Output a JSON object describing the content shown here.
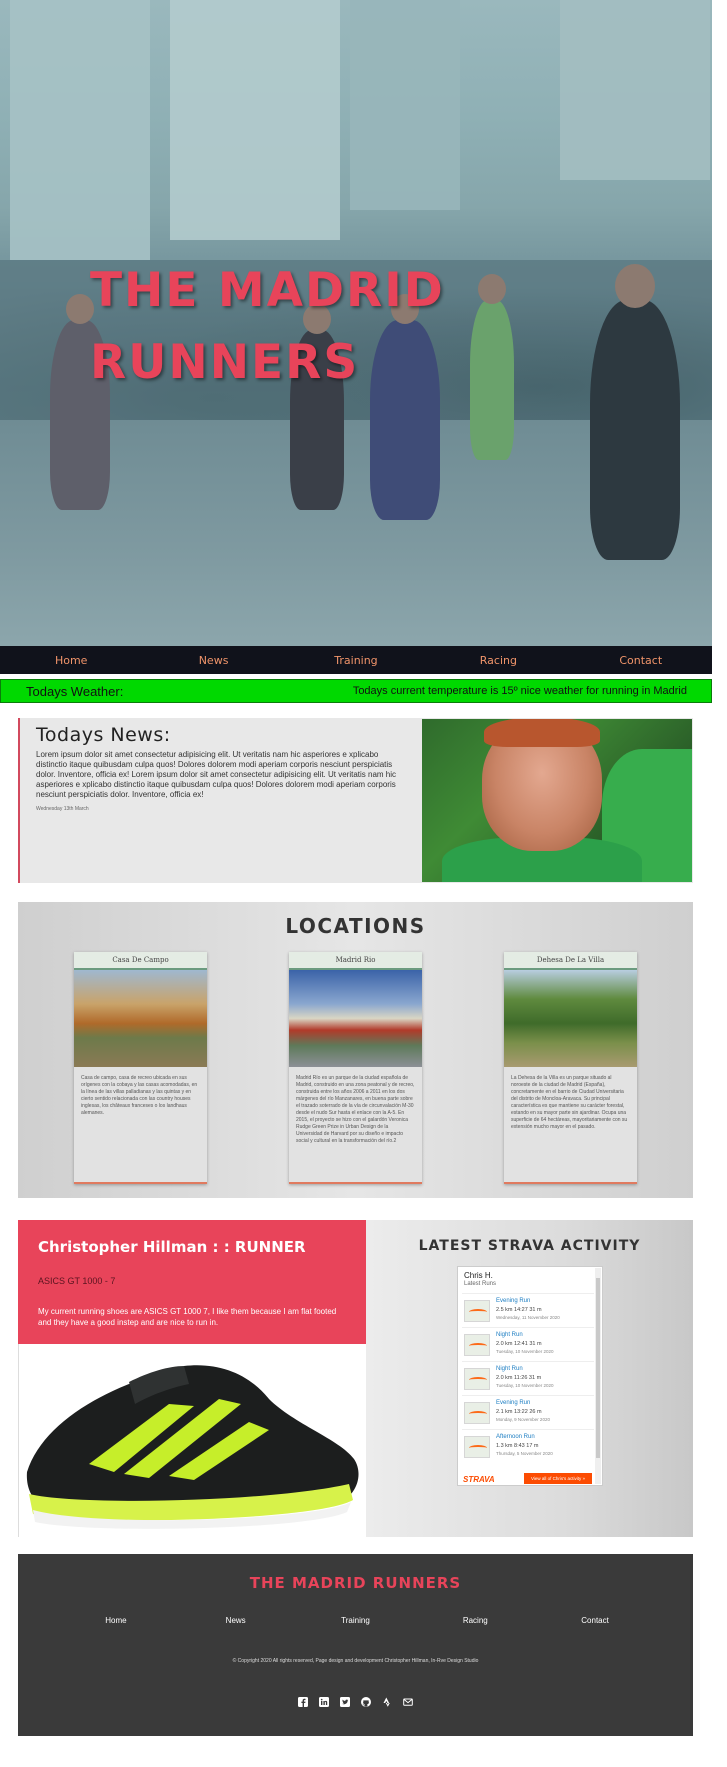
{
  "hero": {
    "title_line1": "THE MADRID",
    "title_line2": "RUNNERS"
  },
  "nav": [
    "Home",
    "News",
    "Training",
    "Racing",
    "Contact"
  ],
  "weather": {
    "label": "Todays Weather:",
    "message": "Todays current temperature is 15º nice weather for running in Madrid"
  },
  "news": {
    "title": "Todays News:",
    "body": "Lorem ipsum dolor sit amet consectetur adipisicing elit. Ut veritatis nam hic asperiores e xplicabo distinctio itaque quibusdam culpa quos! Dolores dolorem modi aperiam corporis nesciunt perspiciatis dolor. Inventore, officia ex! Lorem ipsum dolor sit amet consectetur adipisicing elit. Ut veritatis nam hic asperiores e xplicabo distinctio itaque quibusdam culpa quos! Dolores dolorem modi aperiam corporis nesciunt perspiciatis dolor. Inventore, officia ex!",
    "date": "Wednesday 13th March"
  },
  "locations": {
    "title": "LOCATIONS",
    "cards": [
      {
        "title": "Casa De Campo",
        "text": "Casa de campo, casa de recreo ubicada en sus orígenes con la cobaya y las casas acomodadas, en la línea de las villas palladianas y las quintas y en cierto sentido relacionada con las country houses inglesas, los châteaux franceses o los landhaus alemanes."
      },
      {
        "title": "Madrid Rio",
        "text": "Madrid Río es un parque de la ciudad española de Madrid, construido en una zona peatonal y de recreo, construida entre los años 2006 a 2011 en los dos márgenes del río Manzanares, en buena parte sobre el trazado soterrado de la vía de circunvalación M-30 desde el nudo Sur hasta el enlace con la A-5. En 2015, el proyecto se hizo con el galardón Veronica Rudge Green Prize in Urban Design de la Universidad de Harvard por su diseño e impacto social y cultural en la transformación del río.2"
      },
      {
        "title": "Dehesa De La Villa",
        "text": "La Dehesa de la Villa es un parque situado al noroeste de la ciudad de Madrid (España), concretamente en el barrio de Ciudad Universitaria del distrito de Moncloa-Aravaca. Su principal característica es que mantiene su carácter forestal, estando en su mayor parte sin ajardinar. Ocupa una superficie de 64 hectáreas, mayoritariamente con su extensión mucho mayor en el pasado."
      }
    ]
  },
  "runner": {
    "title": "Christopher Hillman : : RUNNER",
    "model": "ASICS GT 1000 - 7",
    "desc": "My current running shoes are ASICS GT 1000 7, I like them because I am flat footed and they have a good instep and are nice to run in."
  },
  "strava": {
    "title": "LATEST STRAVA ACTIVITY",
    "athlete": "Chris H.",
    "subtitle": "Latest Runs",
    "activities": [
      {
        "name": "Evening Run",
        "stats": "2.5 km    14:27    31 m",
        "date": "Wednesday, 11 November 2020"
      },
      {
        "name": "Night Run",
        "stats": "2.0 km    12:41    31 m",
        "date": "Tuesday, 10 November 2020"
      },
      {
        "name": "Night Run",
        "stats": "2.0 km    11:26    31 m",
        "date": "Tuesday, 10 November 2020"
      },
      {
        "name": "Evening Run",
        "stats": "2.1 km    13:22    26 m",
        "date": "Monday, 9 November 2020"
      },
      {
        "name": "Afternoon Run",
        "stats": "1.3 km    8:43    17 m",
        "date": "Thursday, 5 November 2020"
      }
    ],
    "brand": "STRAVA",
    "view_all": "View all of Chris's activity »"
  },
  "footer": {
    "title": "THE MADRID RUNNERS",
    "nav": [
      "Home",
      "News",
      "Training",
      "Racing",
      "Contact"
    ],
    "copyright": "© Copyright 2020 All rights reserved, Page design and development Christopher Hillman, In-Rve Design Studio",
    "social_icons": [
      "facebook-icon",
      "linkedin-icon",
      "twitter-icon",
      "github-icon",
      "strava-icon",
      "email-icon"
    ]
  },
  "colors": {
    "accent_red": "#e8445a",
    "nav_bg": "#10121b",
    "nav_text": "#f0946a",
    "weather_bg": "#00d900",
    "footer_bg": "#3a3a3a",
    "strava_orange": "#fc4c02"
  }
}
